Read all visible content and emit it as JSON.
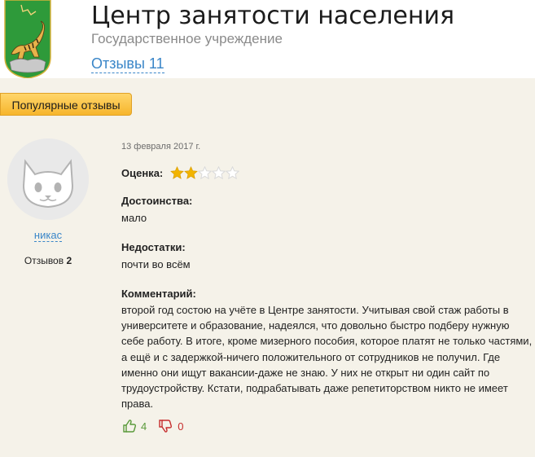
{
  "header": {
    "title": "Центр занятости населения",
    "subtitle": "Государственное учреждение",
    "reviews_link": "Отзывы 11"
  },
  "tabs": {
    "popular": "Популярные отзывы"
  },
  "review": {
    "author": {
      "name": "никас",
      "reviews_label": "Отзывов",
      "reviews_count": "2"
    },
    "date": "13 февраля 2017 г.",
    "rating": {
      "label": "Оценка:",
      "value": 2,
      "max": 5
    },
    "pros": {
      "label": "Достоинства:",
      "text": "мало"
    },
    "cons": {
      "label": "Недостатки:",
      "text": "почти во всём"
    },
    "comment": {
      "label": "Комментарий:",
      "text": "второй год состою на учёте в Центре занятости. Учитывая свой стаж работы в университете и образование, надеялся, что довольно быстро подберу нужную себе работу. В итоге, кроме мизерного пособия, которое платят не только частями, а ещё и с задержкой-ничего положительного от сотрудников не получил. Где именно они ищут вакансии-даже не знаю. У них не открыт ни один сайт по трудоустройству. Кстати, подрабатывать даже репетиторством никто не имеет права."
    },
    "votes": {
      "up": "4",
      "down": "0"
    }
  },
  "colors": {
    "accent": "#f6b52c",
    "link": "#3a86c8",
    "star_filled": "#f2b400",
    "star_empty": "#d9d9d9",
    "vote_up": "#5a9a3a",
    "vote_down": "#c62d2d"
  },
  "icons": {
    "logo": "tiger-emblem-icon",
    "avatar": "cat-avatar-icon",
    "thumb_up": "thumbs-up-icon",
    "thumb_down": "thumbs-down-icon",
    "star": "star-icon"
  }
}
